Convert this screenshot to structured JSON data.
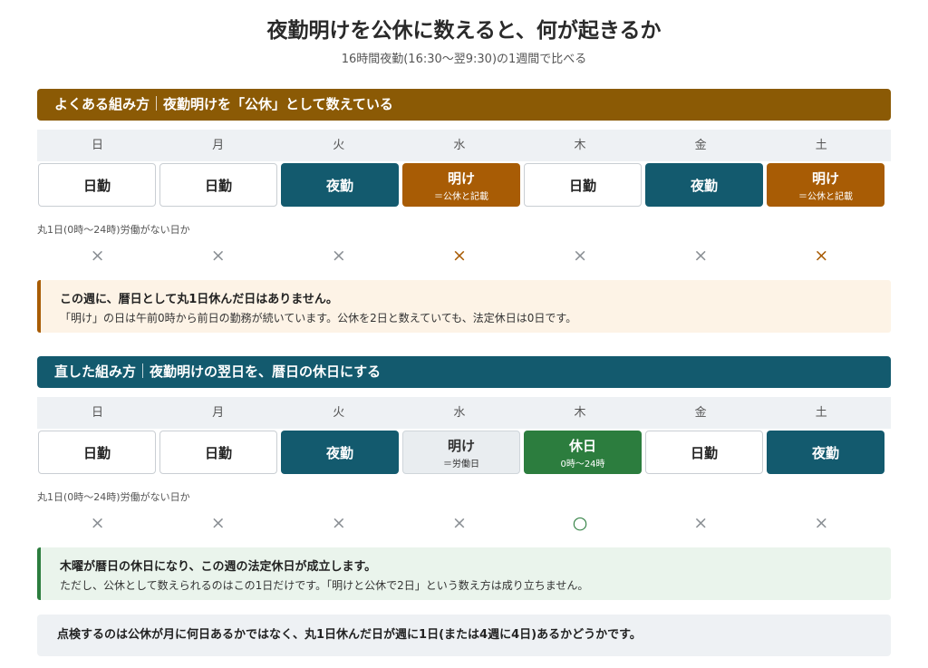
{
  "title": "夜勤明けを公休に数えると、何が起きるか",
  "subtitle": "16時間夜勤(16:30〜翌9:30)の1週間で比べる",
  "colors": {
    "brown": "#8b5a05",
    "teal": "#135a6e",
    "green": "#2c7d3e",
    "grey": "#8a8f94"
  },
  "sections": [
    {
      "header_left": "よくある組み方",
      "header_right": "夜勤明けを「公休」として数えている",
      "days": [
        "日",
        "月",
        "火",
        "水",
        "木",
        "金",
        "土"
      ],
      "cells": [
        {
          "label": "日勤",
          "note": ""
        },
        {
          "label": "日勤",
          "note": ""
        },
        {
          "label": "夜勤",
          "note": ""
        },
        {
          "label": "明け",
          "note": "＝公休と記載"
        },
        {
          "label": "日勤",
          "note": ""
        },
        {
          "label": "夜勤",
          "note": ""
        },
        {
          "label": "明け",
          "note": "＝公休と記載"
        }
      ],
      "caption": "丸1日(0時〜24時)労働がない日か",
      "marks": [
        "×",
        "×",
        "×",
        "×",
        "×",
        "×",
        "×"
      ],
      "note_title": "この週に、暦日として丸1日休んだ日はありません。",
      "note_body": "「明け」の日は午前0時から前日の勤務が続いています。公休を2日と数えていても、法定休日は0日です。"
    },
    {
      "header_left": "直した組み方",
      "header_right": "夜勤明けの翌日を、暦日の休日にする",
      "days": [
        "日",
        "月",
        "火",
        "水",
        "木",
        "金",
        "土"
      ],
      "cells": [
        {
          "label": "日勤",
          "note": ""
        },
        {
          "label": "日勤",
          "note": ""
        },
        {
          "label": "夜勤",
          "note": ""
        },
        {
          "label": "明け",
          "note": "＝労働日"
        },
        {
          "label": "休日",
          "note": "0時〜24時"
        },
        {
          "label": "日勤",
          "note": ""
        },
        {
          "label": "夜勤",
          "note": ""
        }
      ],
      "caption": "丸1日(0時〜24時)労働がない日か",
      "marks": [
        "×",
        "×",
        "×",
        "×",
        "○",
        "×",
        "×"
      ],
      "note_title": "木曜が暦日の休日になり、この週の法定休日が成立します。",
      "note_body": "ただし、公休として数えられるのはこの1日だけです。「明けと公休で2日」という数え方は成り立ちません。"
    }
  ],
  "bottom_text": "点検するのは公休が月に何日あるかではなく、丸1日休んだ日が週に1日(または4週に4日)あるかどうかです。"
}
